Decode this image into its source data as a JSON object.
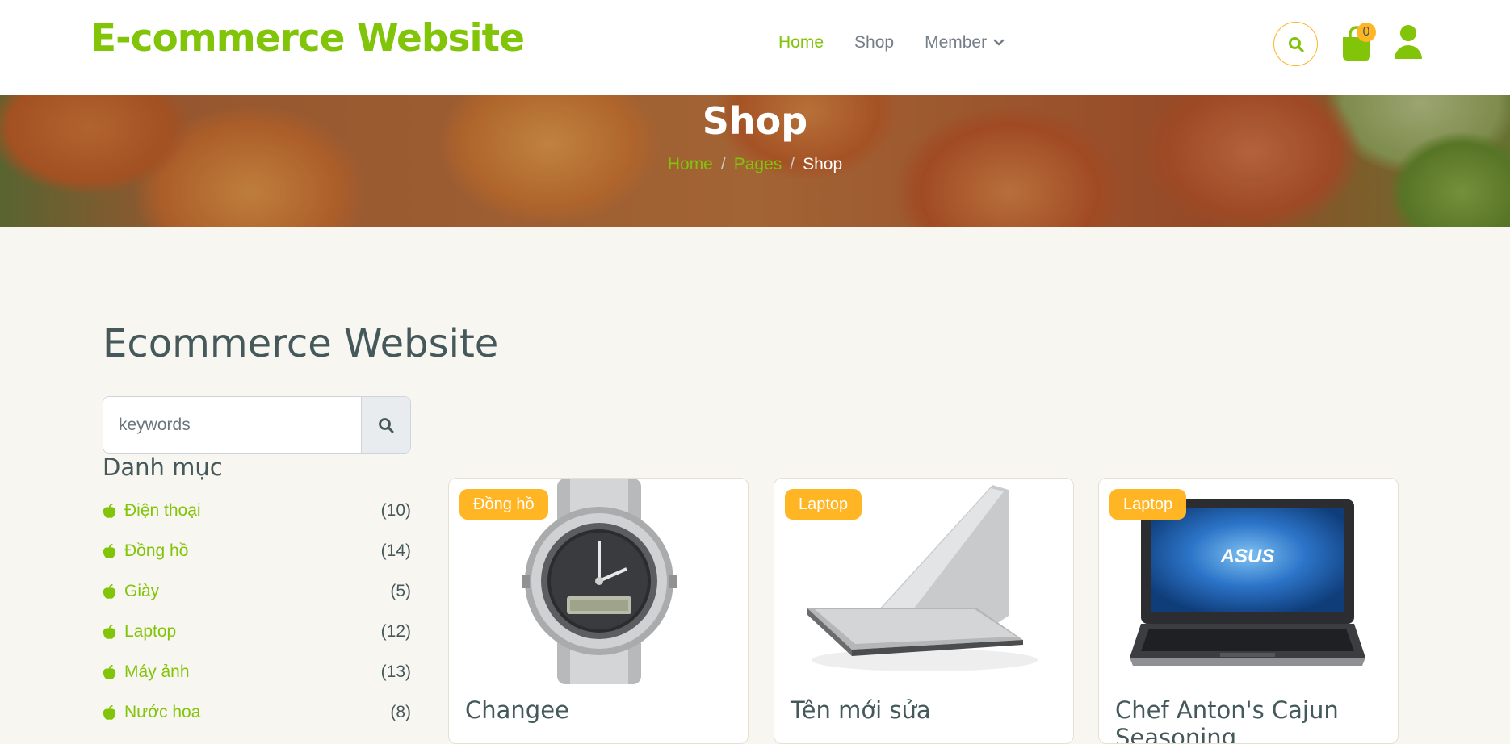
{
  "brand": "E-commerce Website",
  "nav": {
    "links": [
      "Home",
      "Shop",
      "Member"
    ],
    "cart_count": "0"
  },
  "hero": {
    "title": "Shop",
    "breadcrumb": [
      "Home",
      "Pages",
      "Shop"
    ]
  },
  "main": {
    "heading": "Ecommerce Website",
    "search_placeholder": "keywords",
    "category_title": "Danh mục",
    "categories": [
      {
        "name": "Điện thoại",
        "count": "(10)"
      },
      {
        "name": "Đồng hồ",
        "count": "(14)"
      },
      {
        "name": "Giày",
        "count": "(5)"
      },
      {
        "name": "Laptop",
        "count": "(12)"
      },
      {
        "name": "Máy ảnh",
        "count": "(13)"
      },
      {
        "name": "Nước hoa",
        "count": "(8)"
      }
    ]
  },
  "products": [
    {
      "badge": "Đồng hồ",
      "name": "Changee",
      "image": "watch"
    },
    {
      "badge": "Laptop",
      "name": "Tên mới sửa",
      "image": "laptop-silver"
    },
    {
      "badge": "Laptop",
      "name": "Chef Anton's Cajun Seasoning",
      "image": "laptop-asus"
    }
  ],
  "colors": {
    "accent": "#81c408",
    "secondary": "#ffb524",
    "text": "#45595b"
  }
}
